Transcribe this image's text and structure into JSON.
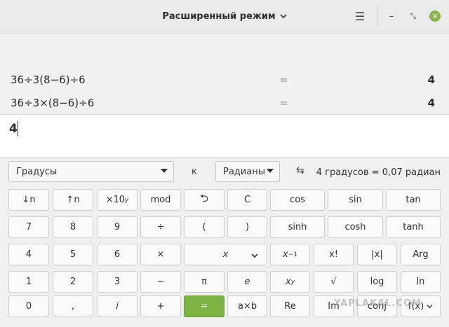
{
  "header": {
    "title": "Расширенный режим",
    "menu_icon": "☰",
    "minimize_icon": "–",
    "maximize_icon": "⤡",
    "close_icon": "✕",
    "close_color": "#8ab34e"
  },
  "history": [
    {
      "expr": "36÷3(8−6)÷6",
      "eq": "=",
      "result": "4"
    },
    {
      "expr": "36÷3×(8−6)÷6",
      "eq": "=",
      "result": "4"
    }
  ],
  "display": {
    "value": "4"
  },
  "converter": {
    "from_unit": "Градусы",
    "to_word": "к",
    "to_unit": "Радианы",
    "swap_icon": "⇆",
    "result": "4 градусов  =  0,07 радиан"
  },
  "keys": {
    "shift_down": "↓n",
    "shift_up": "↑n",
    "times10": "×10",
    "times10_exp": "y",
    "mod": "mod",
    "undo_icon": "⮌",
    "clear": "C",
    "cos": "cos",
    "sin": "sin",
    "tan": "tan",
    "d7": "7",
    "d8": "8",
    "d9": "9",
    "divide": "÷",
    "lparen": "(",
    "rparen": ")",
    "sinh": "sinh",
    "cosh": "cosh",
    "tanh": "tanh",
    "d4": "4",
    "d5": "5",
    "d6": "6",
    "multiply": "×",
    "variable": "x",
    "inverse_base": "x",
    "inverse_exp": "−1",
    "factorial": "x!",
    "abs": "|x|",
    "arg": "Arg",
    "d1": "1",
    "d2": "2",
    "d3": "3",
    "minus": "−",
    "pi": "π",
    "e": "e",
    "power_base": "x",
    "power_exp": "y",
    "sqrt": "√",
    "log": "log",
    "ln": "ln",
    "d0": "0",
    "comma": ",",
    "imag": "i",
    "plus": "+",
    "equals": "=",
    "axb": "a×b",
    "re": "Re",
    "im": "Im",
    "conj": "conj",
    "fx": "f(x)"
  },
  "watermark": "YAPLAKAL.COM",
  "accent": "#7cb342"
}
